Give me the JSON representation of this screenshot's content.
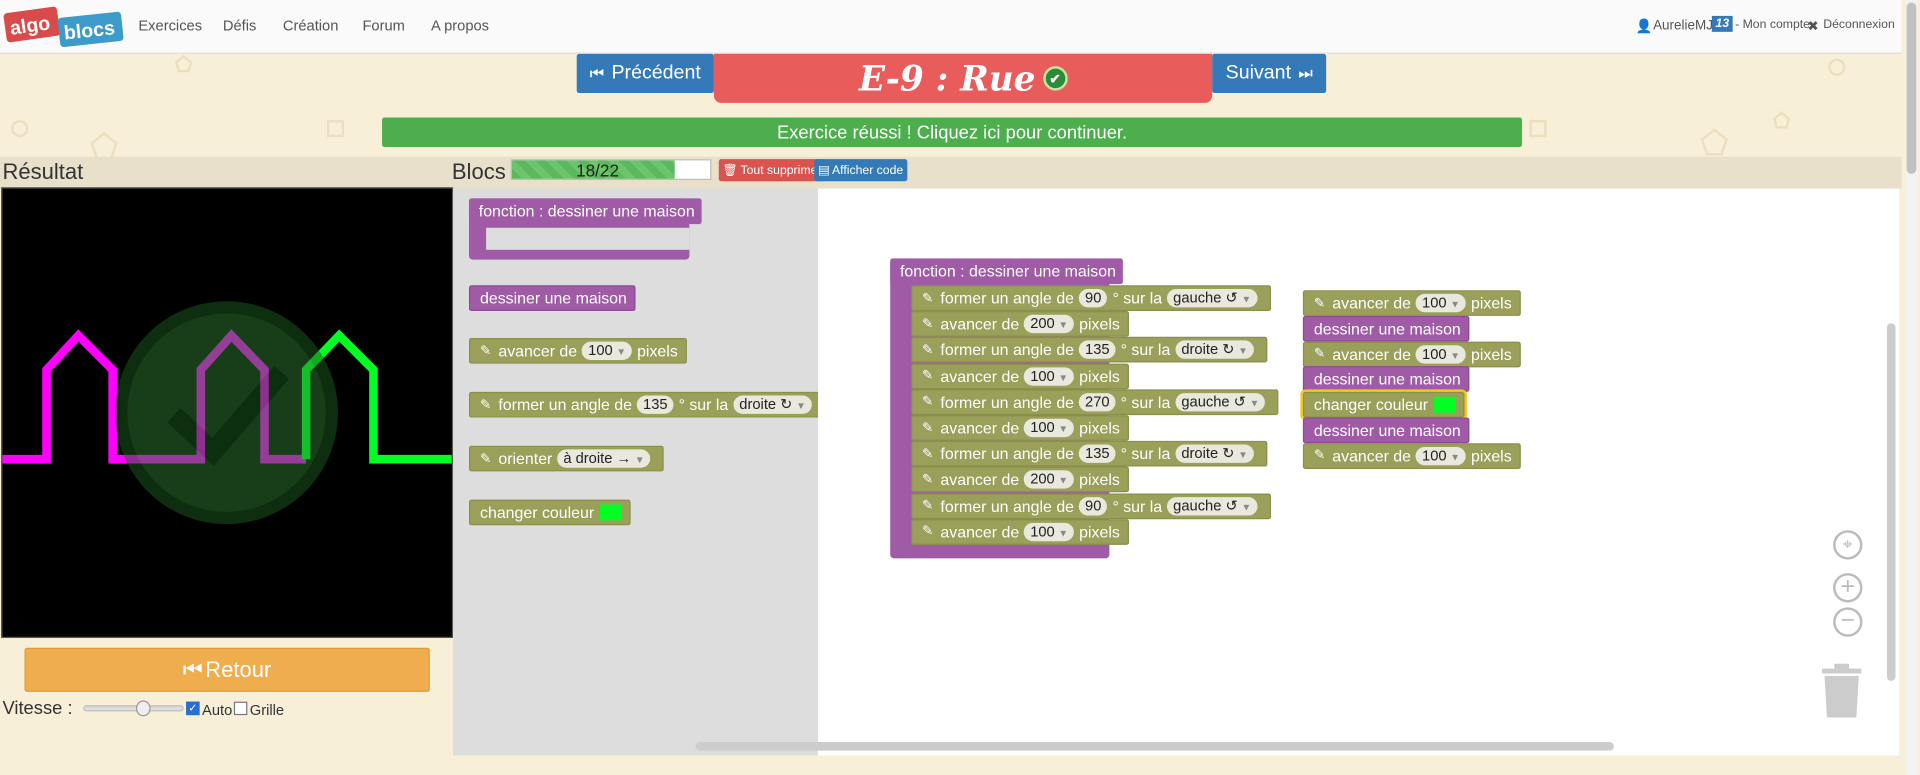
{
  "nav": {
    "logo": {
      "top": "algo",
      "bottom": "blocs"
    },
    "links": [
      "Exercices",
      "Défis",
      "Création",
      "Forum",
      "A propos"
    ],
    "user": {
      "name": "AurelieMJ",
      "badge": "13",
      "account": "- Mon compte",
      "logout": "Déconnexion"
    }
  },
  "exercise": {
    "prev_label": "Précédent",
    "next_label": "Suivant",
    "title": "E-9 : Rue",
    "success_message": "Exercice réussi ! Cliquez ici pour continuer."
  },
  "result": {
    "title": "Résultat",
    "back_label": "Retour",
    "speed_label": "Vitesse :",
    "speed_value": 0.6,
    "auto_label": "Auto",
    "auto_checked": true,
    "grid_label": "Grille",
    "grid_checked": false
  },
  "blocs": {
    "title": "Blocs",
    "counter": "18/22",
    "used": 18,
    "max": 22,
    "delete_all": "Tout supprimer",
    "show_code": "Afficher code"
  },
  "toolbox": {
    "function_def": "fonction : dessiner une maison",
    "call": "dessiner une maison",
    "advance": {
      "pre": "avancer de",
      "value": "100",
      "post": "pixels"
    },
    "turn": {
      "pre": "former un angle de",
      "value": "135",
      "mid": "° sur la",
      "dir": "droite ↻"
    },
    "orient": {
      "pre": "orienter",
      "value": "à droite →"
    },
    "color": {
      "label": "changer couleur",
      "color": "#00ff22"
    }
  },
  "workspace": {
    "function_header": "fonction : dessiner une maison",
    "function_body": [
      {
        "kind": "turn",
        "pre": "former un angle de",
        "value": "90",
        "mid": "° sur la",
        "dir": "gauche ↺"
      },
      {
        "kind": "advance",
        "pre": "avancer de",
        "value": "200",
        "post": "pixels"
      },
      {
        "kind": "turn",
        "pre": "former un angle de",
        "value": "135",
        "mid": "° sur la",
        "dir": "droite ↻"
      },
      {
        "kind": "advance",
        "pre": "avancer de",
        "value": "100",
        "post": "pixels"
      },
      {
        "kind": "turn",
        "pre": "former un angle de",
        "value": "270",
        "mid": "° sur la",
        "dir": "gauche ↺"
      },
      {
        "kind": "advance",
        "pre": "avancer de",
        "value": "100",
        "post": "pixels"
      },
      {
        "kind": "turn",
        "pre": "former un angle de",
        "value": "135",
        "mid": "° sur la",
        "dir": "droite ↻"
      },
      {
        "kind": "advance",
        "pre": "avancer de",
        "value": "200",
        "post": "pixels"
      },
      {
        "kind": "turn",
        "pre": "former un angle de",
        "value": "90",
        "mid": "° sur la",
        "dir": "gauche ↺"
      },
      {
        "kind": "advance",
        "pre": "avancer de",
        "value": "100",
        "post": "pixels"
      }
    ],
    "main_program": [
      {
        "kind": "advance",
        "pre": "avancer de",
        "value": "100",
        "post": "pixels"
      },
      {
        "kind": "call",
        "label": "dessiner une maison"
      },
      {
        "kind": "advance",
        "pre": "avancer de",
        "value": "100",
        "post": "pixels"
      },
      {
        "kind": "call",
        "label": "dessiner une maison"
      },
      {
        "kind": "color",
        "label": "changer couleur",
        "color": "#00ff22"
      },
      {
        "kind": "call",
        "label": "dessiner une maison"
      },
      {
        "kind": "advance",
        "pre": "avancer de",
        "value": "100",
        "post": "pixels"
      }
    ]
  },
  "colors": {
    "nav_button": "#357ab8",
    "title_bg": "#e85c5c",
    "success_bg": "#4cae4c",
    "retour_bg": "#f0ad4e",
    "block_olive": "#9a9f5a",
    "block_purple": "#a05ba6",
    "house_magenta": "#ff00ff",
    "house_green": "#00ff22"
  },
  "icons": {
    "prev": "skip-back-icon",
    "next": "skip-forward-icon",
    "success": "check-circle-icon",
    "user": "user-icon",
    "logout": "close-icon",
    "trash": "trash-icon",
    "code": "code-icon",
    "retour": "rewind-icon"
  }
}
